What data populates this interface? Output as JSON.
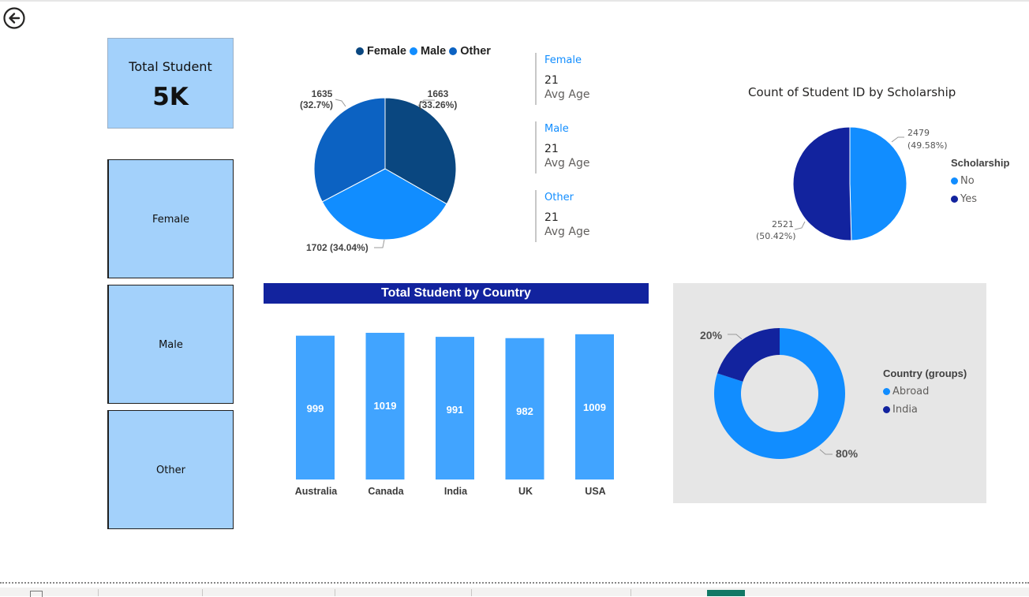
{
  "kpi": {
    "title": "Total Student",
    "value": "5K"
  },
  "slicers": [
    "Female",
    "Male",
    "Other"
  ],
  "gender_legend": [
    {
      "label": "Female",
      "color": "#0a4780"
    },
    {
      "label": "Male",
      "color": "#118dff"
    },
    {
      "label": "Other",
      "color": "#0c62c2"
    }
  ],
  "gender_stats": [
    {
      "name": "Female",
      "value": "21",
      "label": "Avg Age"
    },
    {
      "name": "Male",
      "value": "21",
      "label": "Avg Age"
    },
    {
      "name": "Other",
      "value": "21",
      "label": "Avg Age"
    }
  ],
  "colors": {
    "header": "#12239e",
    "card": "#a3d1fb",
    "bar": "#41a4ff",
    "dark_blue": "#12239e",
    "light_blue": "#118dff"
  },
  "chart_data": [
    {
      "type": "pie",
      "title": "",
      "labels": [
        "Female",
        "Male",
        "Other"
      ],
      "values": [
        1663,
        1702,
        1635
      ],
      "data_labels": [
        "1663 (33.26%)",
        "1702 (34.04%)",
        "1635 (32.7%)"
      ],
      "legend": "top"
    },
    {
      "type": "pie",
      "title": "Count of Student ID by Scholarship",
      "legend_title": "Scholarship",
      "labels": [
        "No",
        "Yes"
      ],
      "values": [
        2479,
        2521
      ],
      "data_labels": [
        "2479 (49.58%)",
        "2521 (50.42%)"
      ],
      "legend": "right"
    },
    {
      "type": "bar",
      "title": "Total Student by Country",
      "categories": [
        "Australia",
        "Canada",
        "India",
        "UK",
        "USA"
      ],
      "values": [
        999,
        1019,
        991,
        982,
        1009
      ],
      "ylim": [
        0,
        1019
      ]
    },
    {
      "type": "pie",
      "subtype": "donut",
      "title": "",
      "legend_title": "Country (groups)",
      "labels": [
        "Abroad",
        "India"
      ],
      "values": [
        80,
        20
      ],
      "data_labels": [
        "80%",
        "20%"
      ],
      "legend": "right"
    }
  ]
}
